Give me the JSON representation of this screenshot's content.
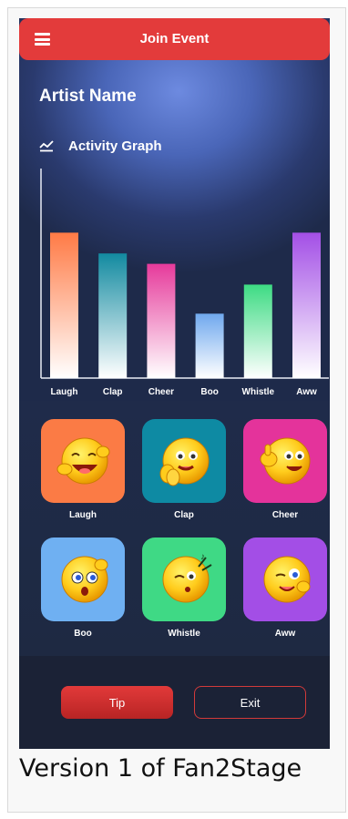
{
  "header": {
    "title": "Join Event"
  },
  "artist": {
    "name": "Artist Name"
  },
  "graph": {
    "title": "Activity Graph"
  },
  "chart_data": {
    "type": "bar",
    "title": "Activity Graph",
    "categories": [
      "Laugh",
      "Clap",
      "Cheer",
      "Boo",
      "Whistle",
      "Aww"
    ],
    "values": [
      0.7,
      0.6,
      0.55,
      0.31,
      0.45,
      0.7
    ],
    "colors": [
      "#ff7a45",
      "#128aa0",
      "#e63a9b",
      "#6fa8ee",
      "#3ddb83",
      "#a34fe6"
    ]
  },
  "reactions": [
    {
      "label": "Laugh",
      "icon": "laugh-emoji-icon",
      "color": "#fb7b45"
    },
    {
      "label": "Clap",
      "icon": "clap-emoji-icon",
      "color": "#0e8aa3"
    },
    {
      "label": "Cheer",
      "icon": "cheer-emoji-icon",
      "color": "#e4339b"
    },
    {
      "label": "Boo",
      "icon": "boo-emoji-icon",
      "color": "#6fb0f2"
    },
    {
      "label": "Whistle",
      "icon": "whistle-emoji-icon",
      "color": "#3fd985"
    },
    {
      "label": "Aww",
      "icon": "aww-emoji-icon",
      "color": "#a34ee6"
    }
  ],
  "actions": {
    "tip_label": "Tip",
    "exit_label": "Exit"
  },
  "caption": "Version 1 of Fan2Stage"
}
